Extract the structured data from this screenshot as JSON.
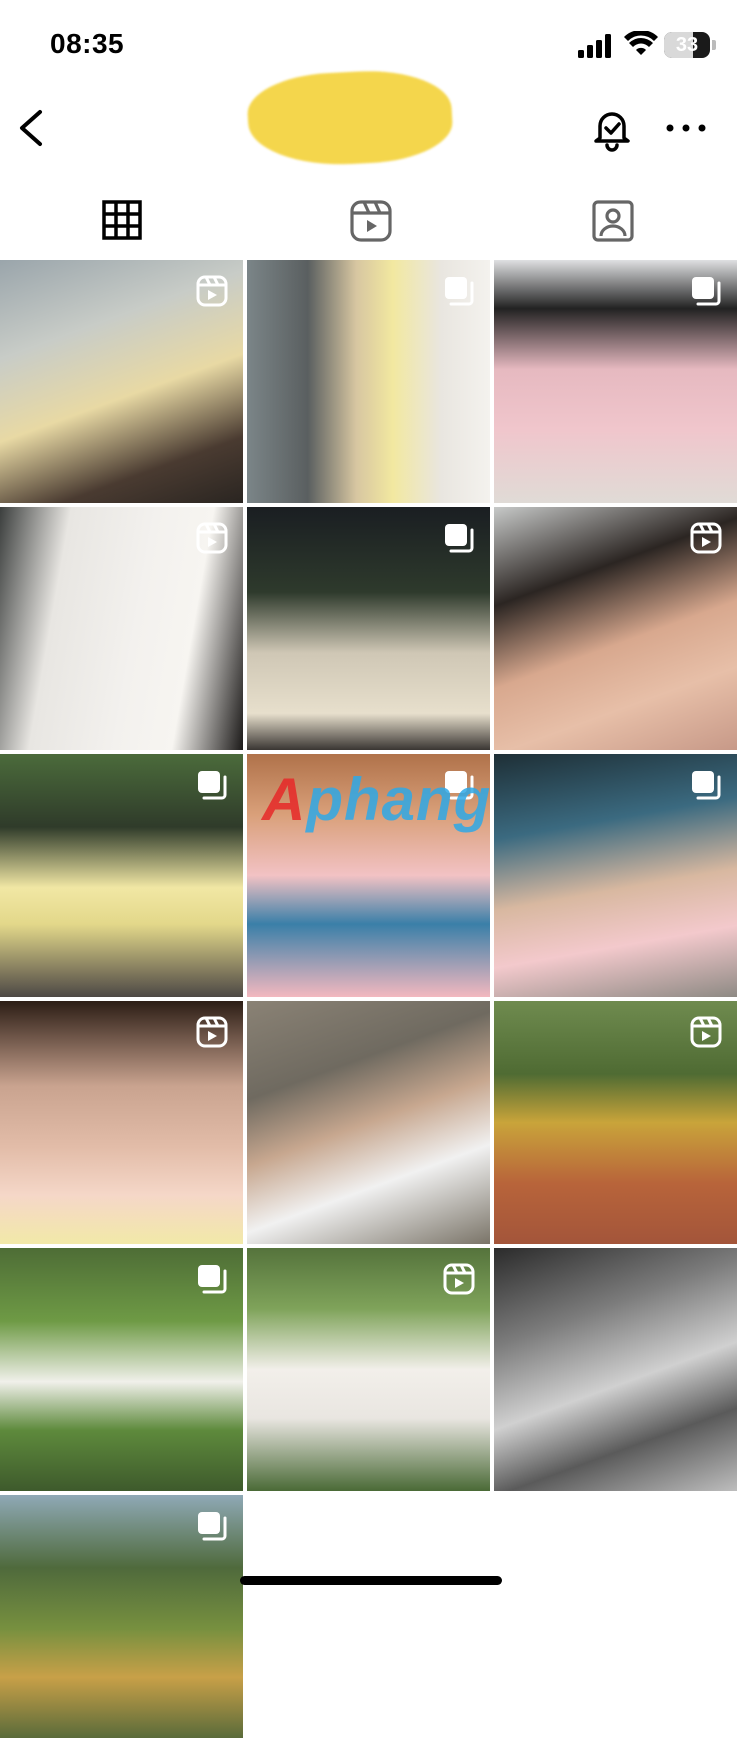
{
  "status_bar": {
    "time": "08:35",
    "battery_percent": "33"
  },
  "header": {
    "username": ""
  },
  "tabs": [
    {
      "icon": "grid-icon",
      "active": true
    },
    {
      "icon": "reels-icon",
      "active": false
    },
    {
      "icon": "tagged-icon",
      "active": false
    }
  ],
  "grid": {
    "items": [
      {
        "type": "reel"
      },
      {
        "type": "carousel"
      },
      {
        "type": "carousel"
      },
      {
        "type": "reel"
      },
      {
        "type": "carousel"
      },
      {
        "type": "reel"
      },
      {
        "type": "carousel"
      },
      {
        "type": "carousel"
      },
      {
        "type": "carousel"
      },
      {
        "type": "reel"
      },
      {
        "type": "none"
      },
      {
        "type": "reel"
      },
      {
        "type": "carousel"
      },
      {
        "type": "reel"
      },
      {
        "type": "none"
      },
      {
        "type": "carousel"
      }
    ]
  },
  "watermark": {
    "prefix": "A",
    "rest": "phang"
  }
}
